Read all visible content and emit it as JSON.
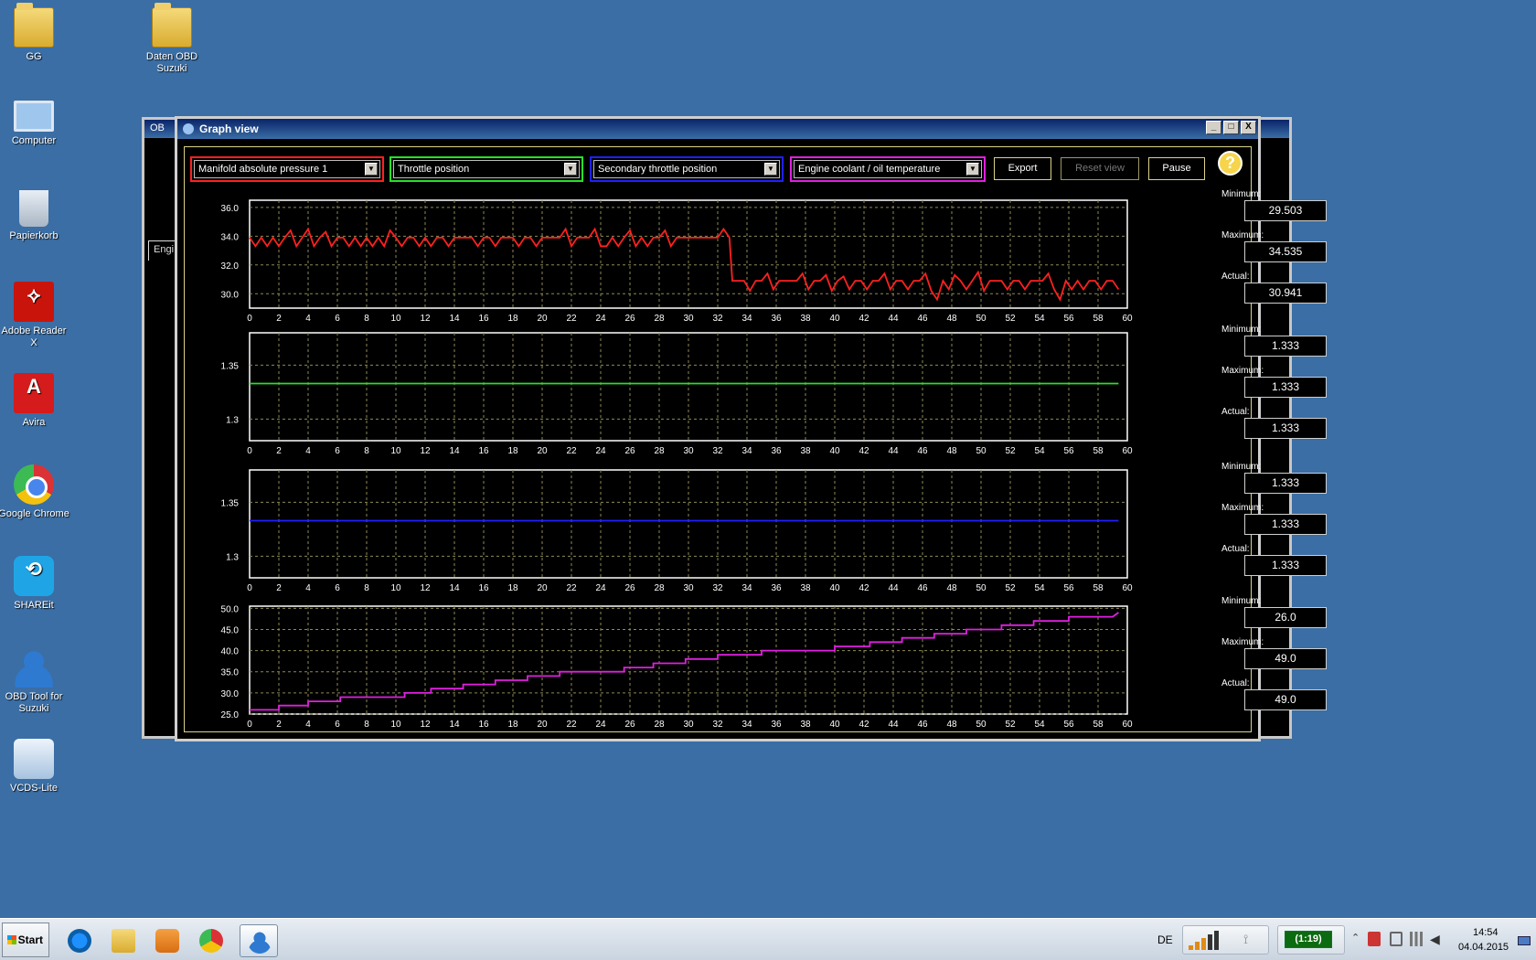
{
  "desktop": {
    "icons": [
      {
        "label": "GG",
        "icon": "folder-user-icon"
      },
      {
        "label": "Daten OBD Suzuki",
        "icon": "folder-icon"
      },
      {
        "label": "Computer",
        "icon": "computer-icon"
      },
      {
        "label": "Papierkorb",
        "icon": "recycle-bin-icon"
      },
      {
        "label": "Adobe Reader X",
        "icon": "adobe-reader-icon"
      },
      {
        "label": "Avira",
        "icon": "avira-icon"
      },
      {
        "label": "Google Chrome",
        "icon": "chrome-icon"
      },
      {
        "label": "SHAREit",
        "icon": "shareit-icon"
      },
      {
        "label": "OBD Tool for Suzuki",
        "icon": "obd-tool-icon"
      },
      {
        "label": "VCDS-Lite",
        "icon": "vcds-icon"
      }
    ]
  },
  "back_window": {
    "title": "OB",
    "tab": "Engi"
  },
  "window": {
    "title": "Graph view",
    "controls": {
      "minimize": "_",
      "maximize": "□",
      "close": "X"
    }
  },
  "toolbar": {
    "selectors": [
      {
        "value": "Manifold absolute pressure 1",
        "color": "#ff2020"
      },
      {
        "value": "Throttle position",
        "color": "#28e028"
      },
      {
        "value": "Secondary throttle position",
        "color": "#2020ff"
      },
      {
        "value": "Engine coolant / oil temperature",
        "color": "#e020e0"
      }
    ],
    "export_label": "Export",
    "reset_label": "Reset view",
    "pause_label": "Pause",
    "help_label": "?"
  },
  "stats": [
    {
      "min_label": "Minimum:",
      "min": "29.503",
      "max_label": "Maximum:",
      "max": "34.535",
      "act_label": "Actual:",
      "act": "30.941"
    },
    {
      "min_label": "Minimum:",
      "min": "1.333",
      "max_label": "Maximum:",
      "max": "1.333",
      "act_label": "Actual:",
      "act": "1.333"
    },
    {
      "min_label": "Minimum:",
      "min": "1.333",
      "max_label": "Maximum:",
      "max": "1.333",
      "act_label": "Actual:",
      "act": "1.333"
    },
    {
      "min_label": "Minimum:",
      "min": "26.0",
      "max_label": "Maximum:",
      "max": "49.0",
      "act_label": "Actual:",
      "act": "49.0"
    }
  ],
  "chart_data": [
    {
      "type": "line",
      "color": "#ff2020",
      "grid": true,
      "xlim": [
        0,
        60
      ],
      "ylim": [
        29,
        36.5
      ],
      "xticks": [
        "0",
        "2",
        "4",
        "6",
        "8",
        "10",
        "12",
        "14",
        "16",
        "18",
        "20",
        "22",
        "24",
        "26",
        "28",
        "30",
        "32",
        "34",
        "36",
        "38",
        "40",
        "42",
        "44",
        "46",
        "48",
        "50",
        "52",
        "54",
        "56",
        "58",
        "60"
      ],
      "yticks": [
        "30.0",
        "32.0",
        "34.0",
        "36.0"
      ],
      "ytick_values": [
        30,
        32,
        34,
        36
      ],
      "x": [
        0,
        0.4,
        0.8,
        1.2,
        1.6,
        2.0,
        2.4,
        2.8,
        3.2,
        3.6,
        4.0,
        4.4,
        4.8,
        5.2,
        5.6,
        6.0,
        6.4,
        6.8,
        7.2,
        7.6,
        8.0,
        8.4,
        8.8,
        9.2,
        9.6,
        10.0,
        10.4,
        10.8,
        11.2,
        11.6,
        12.0,
        12.4,
        12.8,
        13.2,
        13.6,
        14.0,
        14.4,
        14.8,
        15.2,
        15.6,
        16.0,
        16.4,
        16.8,
        17.2,
        17.6,
        18.0,
        18.4,
        18.8,
        19.2,
        19.6,
        20.0,
        20.4,
        20.8,
        21.2,
        21.6,
        22.0,
        22.4,
        22.8,
        23.2,
        23.6,
        24.0,
        24.4,
        24.8,
        25.2,
        25.6,
        26.0,
        26.4,
        26.8,
        27.2,
        27.6,
        28.0,
        28.4,
        28.8,
        29.2,
        29.6,
        30.0,
        30.4,
        30.8,
        31.2,
        31.6,
        32.0,
        32.4,
        32.8,
        33.0,
        33.4,
        33.8,
        34.2,
        34.6,
        35.0,
        35.4,
        35.8,
        36.2,
        36.6,
        37.0,
        37.4,
        37.8,
        38.2,
        38.6,
        39.0,
        39.4,
        39.8,
        40.2,
        40.6,
        41.0,
        41.4,
        41.8,
        42.2,
        42.6,
        43.0,
        43.4,
        43.8,
        44.2,
        44.6,
        45.0,
        45.4,
        45.8,
        46.2,
        46.6,
        47.0,
        47.4,
        47.8,
        48.2,
        48.6,
        49.0,
        49.4,
        49.8,
        50.2,
        50.6,
        51.0,
        51.4,
        51.8,
        52.2,
        52.6,
        53.0,
        53.4,
        53.8,
        54.2,
        54.6,
        55.0,
        55.4,
        55.8,
        56.2,
        56.6,
        57.0,
        57.4,
        57.8,
        58.2,
        58.6,
        59.0,
        59.4
      ],
      "y": [
        33.9,
        33.3,
        33.9,
        33.3,
        33.9,
        33.3,
        33.9,
        34.4,
        33.3,
        33.9,
        34.5,
        33.3,
        33.9,
        34.3,
        33.3,
        33.9,
        33.9,
        33.3,
        33.9,
        33.3,
        33.9,
        33.3,
        33.9,
        33.3,
        34.4,
        33.9,
        33.3,
        33.9,
        33.9,
        33.3,
        33.9,
        33.3,
        33.9,
        33.9,
        33.3,
        33.9,
        33.9,
        33.9,
        33.9,
        33.3,
        33.9,
        33.9,
        33.3,
        33.9,
        33.9,
        33.9,
        33.3,
        33.9,
        33.9,
        33.3,
        33.9,
        33.9,
        33.9,
        33.9,
        34.5,
        33.3,
        33.9,
        33.9,
        33.9,
        34.5,
        33.3,
        33.3,
        33.9,
        33.3,
        33.9,
        34.4,
        33.3,
        33.9,
        33.3,
        33.9,
        33.9,
        34.4,
        33.3,
        33.9,
        33.9,
        33.9,
        33.9,
        33.9,
        33.9,
        33.9,
        33.9,
        34.5,
        33.9,
        30.9,
        30.9,
        30.9,
        30.2,
        30.9,
        30.9,
        31.4,
        30.3,
        30.9,
        30.9,
        30.9,
        30.9,
        31.4,
        30.3,
        30.9,
        30.9,
        31.3,
        30.2,
        30.9,
        31.2,
        30.3,
        30.9,
        30.9,
        30.3,
        30.9,
        30.9,
        31.4,
        30.3,
        30.9,
        30.9,
        30.3,
        30.9,
        30.9,
        31.4,
        30.2,
        29.6,
        30.9,
        30.3,
        31.3,
        30.9,
        30.3,
        30.9,
        31.5,
        30.2,
        30.9,
        30.9,
        30.9,
        30.3,
        30.9,
        30.9,
        30.3,
        30.9,
        30.9,
        30.9,
        31.4,
        30.3,
        29.6,
        30.9,
        30.3,
        30.9,
        30.3,
        30.9,
        30.9,
        30.3,
        30.9,
        30.9,
        30.3,
        30.9,
        30.3,
        30.9,
        30.3,
        30.9,
        30.3,
        30.9,
        30.3,
        30.9
      ]
    },
    {
      "type": "line",
      "color": "#28e028",
      "grid": true,
      "xlim": [
        0,
        60
      ],
      "ylim": [
        1.28,
        1.38
      ],
      "xticks": [
        "0",
        "2",
        "4",
        "6",
        "8",
        "10",
        "12",
        "14",
        "16",
        "18",
        "20",
        "22",
        "24",
        "26",
        "28",
        "30",
        "32",
        "34",
        "36",
        "38",
        "40",
        "42",
        "44",
        "46",
        "48",
        "50",
        "52",
        "54",
        "56",
        "58",
        "60"
      ],
      "yticks": [
        "1.3",
        "1.35"
      ],
      "ytick_values": [
        1.3,
        1.35
      ],
      "x": [
        0,
        59.4
      ],
      "y": [
        1.333,
        1.333
      ]
    },
    {
      "type": "line",
      "color": "#2020ff",
      "grid": true,
      "xlim": [
        0,
        60
      ],
      "ylim": [
        1.28,
        1.38
      ],
      "xticks": [
        "0",
        "2",
        "4",
        "6",
        "8",
        "10",
        "12",
        "14",
        "16",
        "18",
        "20",
        "22",
        "24",
        "26",
        "28",
        "30",
        "32",
        "34",
        "36",
        "38",
        "40",
        "42",
        "44",
        "46",
        "48",
        "50",
        "52",
        "54",
        "56",
        "58",
        "60"
      ],
      "yticks": [
        "1.3",
        "1.35"
      ],
      "ytick_values": [
        1.3,
        1.35
      ],
      "x": [
        0,
        59.4
      ],
      "y": [
        1.333,
        1.333
      ]
    },
    {
      "type": "line",
      "color": "#e020e0",
      "grid": true,
      "xlim": [
        0,
        60
      ],
      "ylim": [
        25,
        50.5
      ],
      "xticks": [
        "0",
        "2",
        "4",
        "6",
        "8",
        "10",
        "12",
        "14",
        "16",
        "18",
        "20",
        "22",
        "24",
        "26",
        "28",
        "30",
        "32",
        "34",
        "36",
        "38",
        "40",
        "42",
        "44",
        "46",
        "48",
        "50",
        "52",
        "54",
        "56",
        "58",
        "60"
      ],
      "yticks": [
        "25.0",
        "30.0",
        "35.0",
        "40.0",
        "45.0",
        "50.0"
      ],
      "ytick_values": [
        25,
        30,
        35,
        40,
        45,
        50
      ],
      "x": [
        0,
        2.0,
        2.0,
        4.0,
        4.0,
        6.2,
        6.2,
        8.4,
        8.4,
        10.6,
        10.6,
        12.4,
        12.4,
        14.6,
        14.6,
        16.8,
        16.8,
        19.0,
        19.0,
        21.2,
        21.2,
        23.4,
        23.4,
        25.6,
        25.6,
        27.6,
        27.6,
        29.8,
        29.8,
        32.0,
        32.0,
        35.0,
        35.0,
        38.0,
        38.0,
        40.0,
        40.0,
        42.4,
        42.4,
        44.6,
        44.6,
        46.8,
        46.8,
        49.0,
        49.0,
        51.4,
        51.4,
        53.6,
        53.6,
        56.0,
        56.0,
        58.2,
        58.2,
        59.0,
        59.4
      ],
      "y": [
        26,
        26,
        27,
        27,
        28,
        28,
        29,
        29,
        29,
        29,
        30,
        30,
        31,
        31,
        32,
        32,
        33,
        33,
        34,
        34,
        35,
        35,
        35,
        35,
        36,
        36,
        37,
        37,
        38,
        38,
        39,
        39,
        40,
        40,
        40,
        40,
        41,
        41,
        42,
        42,
        43,
        43,
        44,
        44,
        45,
        45,
        46,
        46,
        47,
        47,
        48,
        48,
        48,
        48,
        49
      ]
    }
  ],
  "taskbar": {
    "start_label": "Start",
    "language": "DE",
    "battery": "(1:19)",
    "time": "14:54",
    "date": "04.04.2015",
    "pinned": [
      "internet-explorer-icon",
      "explorer-folder-icon",
      "media-player-icon",
      "chrome-icon",
      "obd-tool-icon"
    ]
  }
}
